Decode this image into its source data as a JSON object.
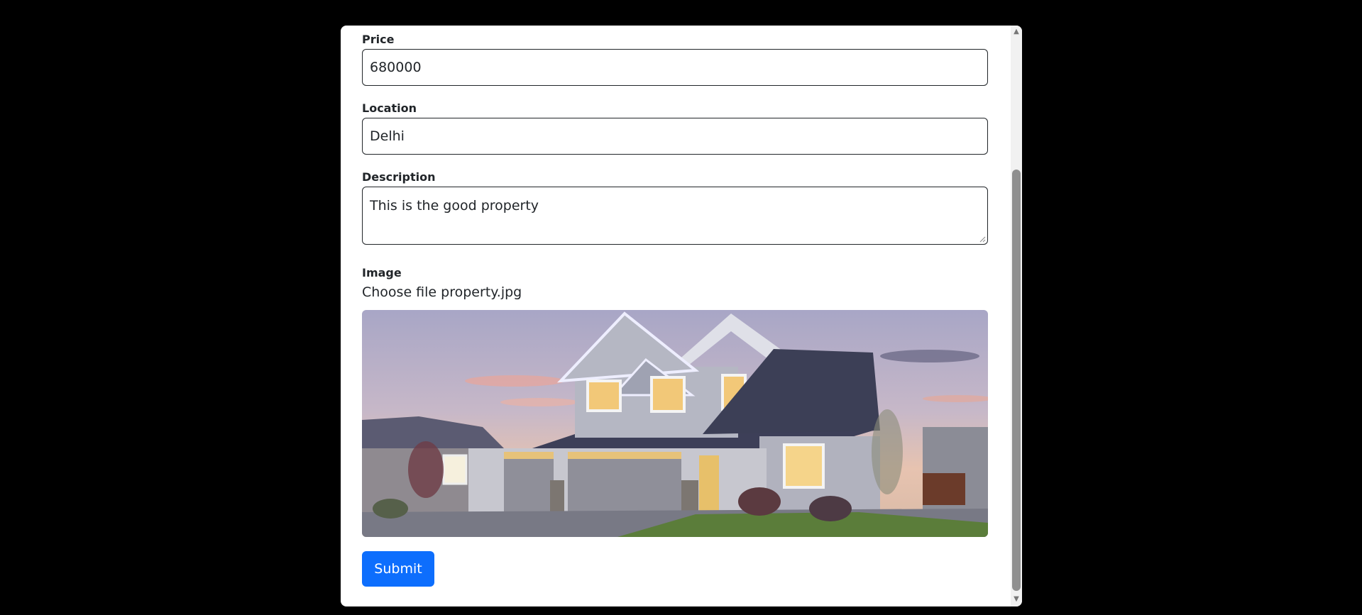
{
  "form": {
    "price": {
      "label": "Price",
      "value": "680000"
    },
    "location": {
      "label": "Location",
      "value": "Delhi"
    },
    "description": {
      "label": "Description",
      "value": "This is the good property"
    },
    "image": {
      "label": "Image",
      "choose_label": "Choose file",
      "file_name": "property.jpg"
    },
    "submit_label": "Submit"
  },
  "colors": {
    "primary": "#0d6efd",
    "border": "#212529"
  }
}
